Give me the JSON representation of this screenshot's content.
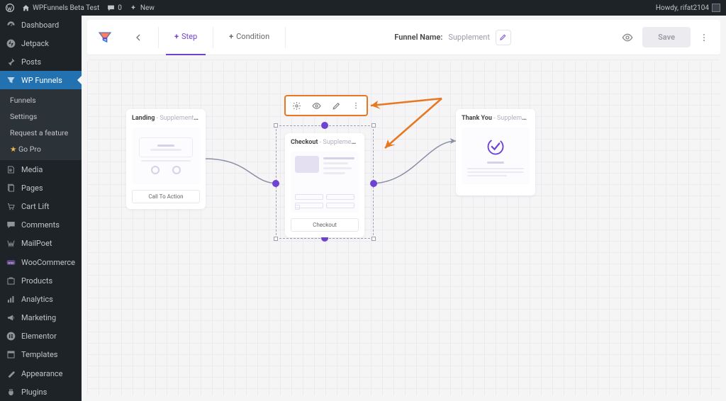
{
  "adminbar": {
    "site_name": "WPFunnels Beta Test",
    "comments": "0",
    "new_label": "New",
    "howdy": "Howdy, rifat2104"
  },
  "sidebar": {
    "items": [
      {
        "label": "Dashboard",
        "icon": "dashboard-icon"
      },
      {
        "label": "Jetpack",
        "icon": "jetpack-icon"
      },
      {
        "label": "Posts",
        "icon": "pin-icon",
        "sep_before": true
      },
      {
        "label": "WP Funnels",
        "icon": "wpfunnels-icon",
        "active": true
      },
      {
        "label": "Media",
        "icon": "media-icon",
        "sep_before": true
      },
      {
        "label": "Pages",
        "icon": "pages-icon"
      },
      {
        "label": "Cart Lift",
        "icon": "cartlift-icon"
      },
      {
        "label": "Comments",
        "icon": "comments-icon"
      },
      {
        "label": "MailPoet",
        "icon": "mailpoet-icon"
      },
      {
        "label": "WooCommerce",
        "icon": "woocommerce-icon",
        "sep_before": true
      },
      {
        "label": "Products",
        "icon": "products-icon"
      },
      {
        "label": "Analytics",
        "icon": "analytics-icon"
      },
      {
        "label": "Marketing",
        "icon": "marketing-icon"
      },
      {
        "label": "Elementor",
        "icon": "elementor-icon",
        "sep_before": true
      },
      {
        "label": "Templates",
        "icon": "templates-icon"
      },
      {
        "label": "Appearance",
        "icon": "appearance-icon",
        "sep_before": true
      },
      {
        "label": "Plugins",
        "icon": "plugins-icon"
      }
    ],
    "submenu": [
      {
        "label": "Funnels"
      },
      {
        "label": "Settings"
      },
      {
        "label": "Request a feature"
      },
      {
        "label": "Go Pro",
        "starred": true
      }
    ]
  },
  "toolbar": {
    "step_label": "Step",
    "condition_label": "Condition",
    "funnel_name_label": "Funnel Name:",
    "funnel_name_value": "Supplement",
    "save_label": "Save"
  },
  "actionbar": {
    "items": [
      "settings-icon",
      "eye-icon",
      "pencil-icon",
      "more-vertical-icon"
    ]
  },
  "nodes": {
    "landing": {
      "title": "Landing",
      "sub": " - Supplement La...",
      "cta": "Call To Action"
    },
    "checkout": {
      "title": "Checkout",
      "sub": " - Supplement C...",
      "cta": "Checkout"
    },
    "thankyou": {
      "title": "Thank You",
      "sub": " - Supplement T..."
    }
  }
}
